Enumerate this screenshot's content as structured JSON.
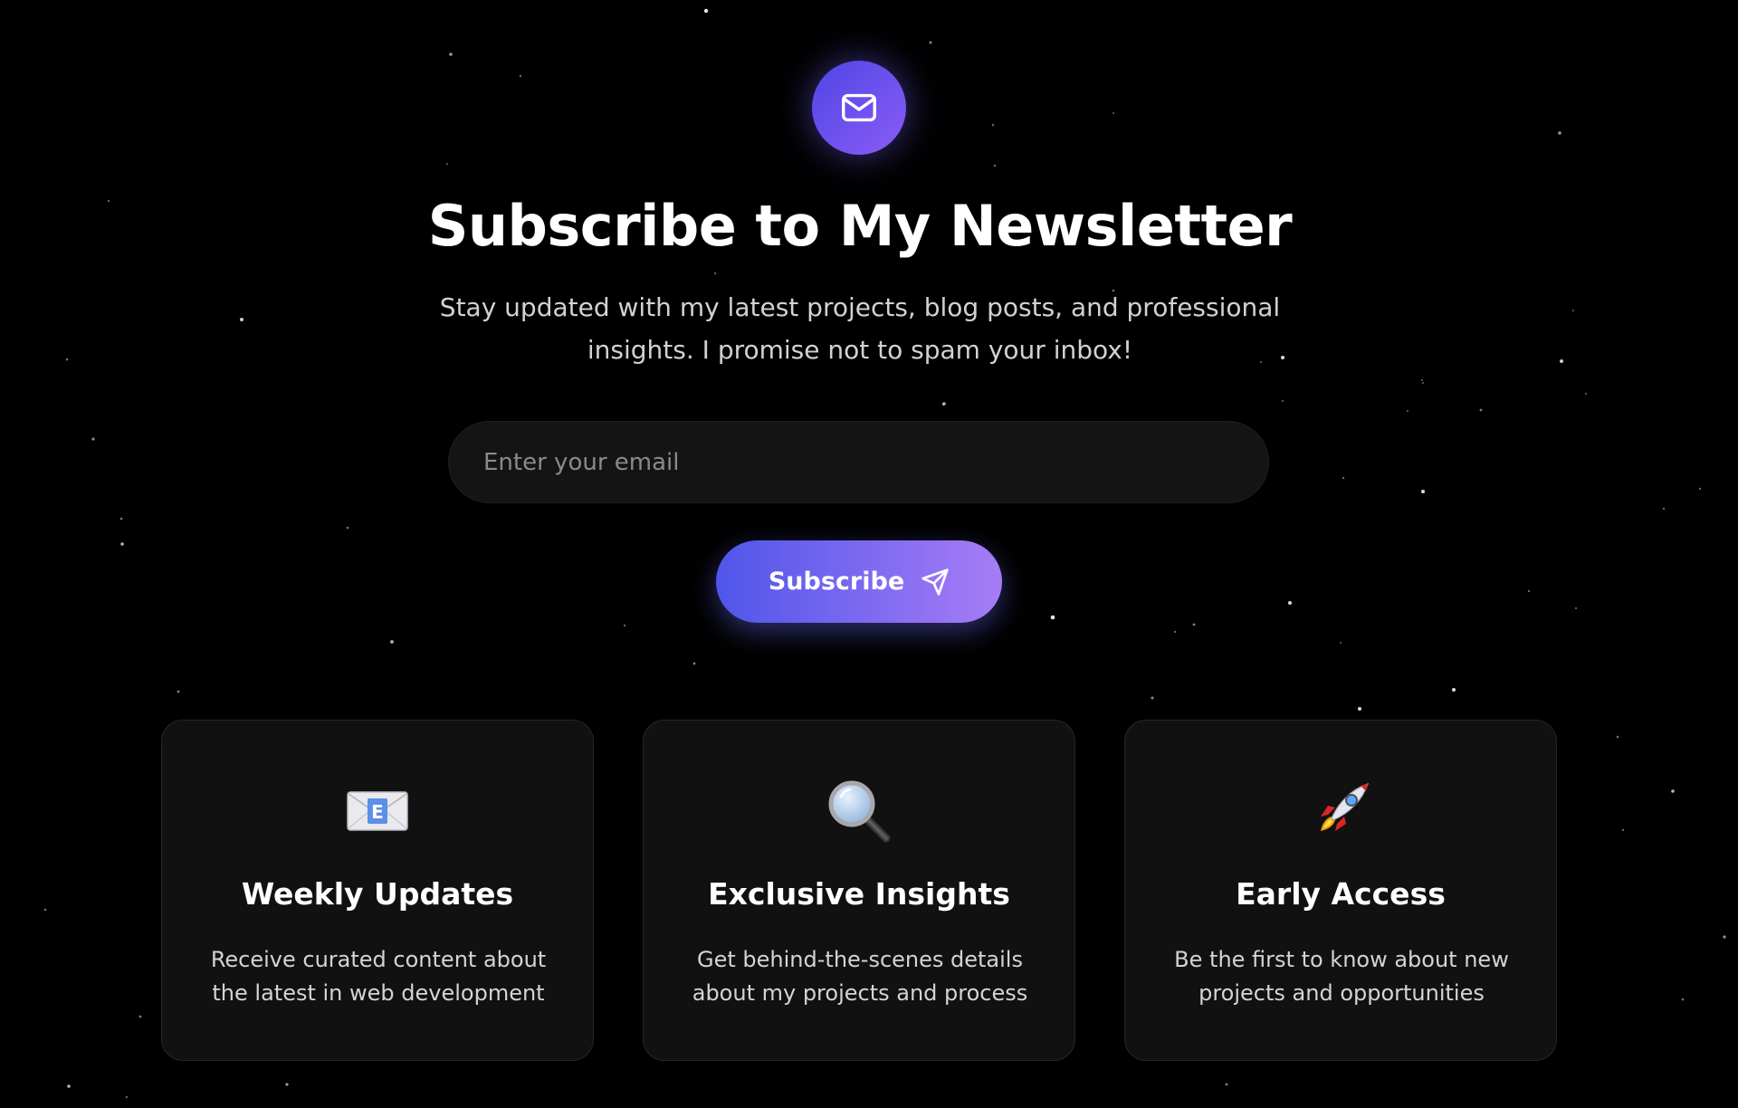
{
  "colors": {
    "background": "#000000",
    "accent_start": "#4f46e5",
    "accent_end": "#a77cf6",
    "card_background": "#111111",
    "input_background": "#141414"
  },
  "header": {
    "icon": "mail-icon",
    "title": "Subscribe to My Newsletter",
    "subtitle_line1": "Stay updated with my latest projects, blog posts, and professional",
    "subtitle_line2": "insights. I promise not to spam your inbox!"
  },
  "form": {
    "email_placeholder": "Enter your email",
    "email_value": "",
    "subscribe_label": "Subscribe",
    "subscribe_icon": "send-icon"
  },
  "features": [
    {
      "icon": "envelope-emoji-icon",
      "title": "Weekly Updates",
      "text_line1": "Receive curated content about",
      "text_line2": "the latest in web development"
    },
    {
      "icon": "magnifying-glass-emoji-icon",
      "title": "Exclusive Insights",
      "text_line1": "Get behind-the-scenes details",
      "text_line2": "about my projects and process"
    },
    {
      "icon": "rocket-emoji-icon",
      "title": "Early Access",
      "text_line1": "Be the first to know about new",
      "text_line2": "projects and opportunities"
    }
  ]
}
